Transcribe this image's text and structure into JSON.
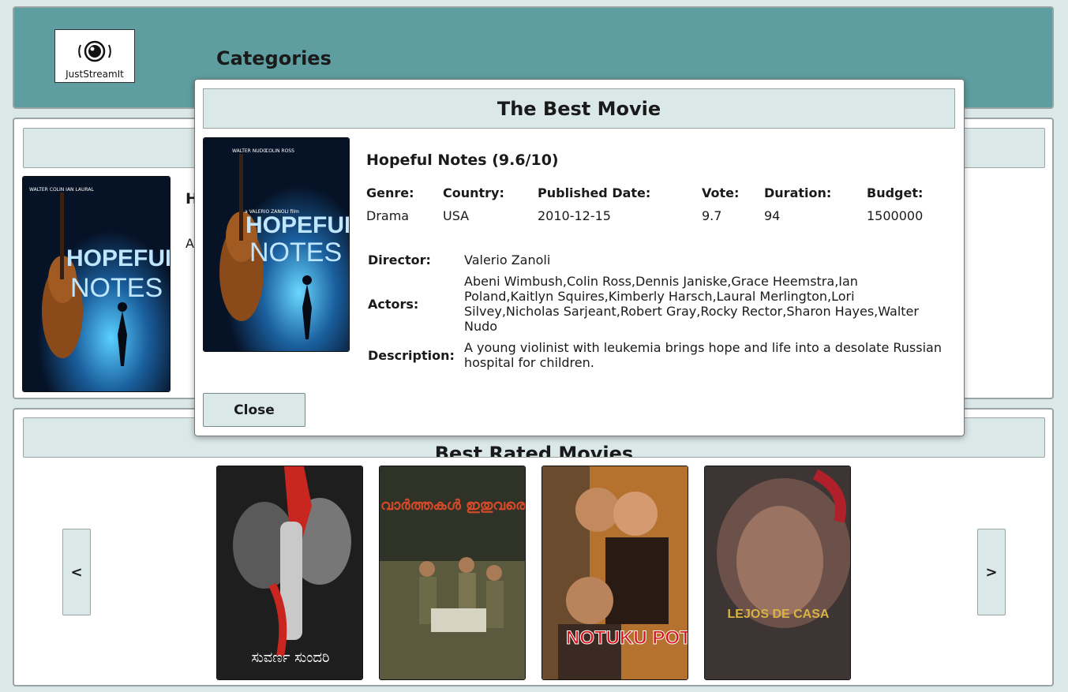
{
  "header": {
    "logo_text": "JustStreamIt",
    "categories_title": "Categories"
  },
  "best_section": {
    "peek_title": "H",
    "peek_desc": "A"
  },
  "rated_section": {
    "title": "Best Rated Movies",
    "prev_label": "<",
    "next_label": ">",
    "posters": [
      {
        "title_text": "ಸುವರ್ಣ ಸುಂದರಿ",
        "bg": "#2a2a2a",
        "accent": "#c8261f"
      },
      {
        "title_text": "വാർത്തകൾ ഇതുവരെ",
        "bg": "#3b3a2c",
        "accent": "#d24a2a"
      },
      {
        "title_text": "NOTUKU POTU",
        "bg": "#8a4a1e",
        "accent": "#d5141c"
      },
      {
        "title_text": "LEJOS DE CASA",
        "bg": "#6b5a55",
        "accent": "#d9b443"
      }
    ]
  },
  "modal": {
    "title": "The Best Movie",
    "movie_heading": "Hopeful Notes (9.6/10)",
    "meta_headers": [
      "Genre:",
      "Country:",
      "Published Date:",
      "Vote:",
      "Duration:",
      "Budget:"
    ],
    "meta_values": [
      "Drama",
      "USA",
      "2010-12-15",
      "9.7",
      "94",
      "1500000"
    ],
    "director_label": "Director:",
    "director": "Valerio Zanoli",
    "actors_label": "Actors:",
    "actors": "Abeni Wimbush,Colin Ross,Dennis Janiske,Grace Heemstra,Ian Poland,Kaitlyn Squires,Kimberly Harsch,Laural Merlington,Lori Silvey,Nicholas Sarjeant,Robert Gray,Rocky Rector,Sharon Hayes,Walter Nudo",
    "description_label": "Description:",
    "description": "A young violinist with leukemia brings hope and life into a desolate Russian hospital for children.",
    "close_label": "Close"
  },
  "poster_art": {
    "cast_names": [
      "WALTER NUDO",
      "COLIN ROSS",
      "IAN POLAND",
      "LAURAL MERLINGTON"
    ],
    "director_line": "a VALERIO ZANOLI film",
    "title_line1": "HOPEFUL",
    "title_line2": "NOTES"
  },
  "colors": {
    "header_bg": "#5f9ea0",
    "page_bg": "#dbe8e8",
    "bar_bg": "#dbe8e8"
  }
}
